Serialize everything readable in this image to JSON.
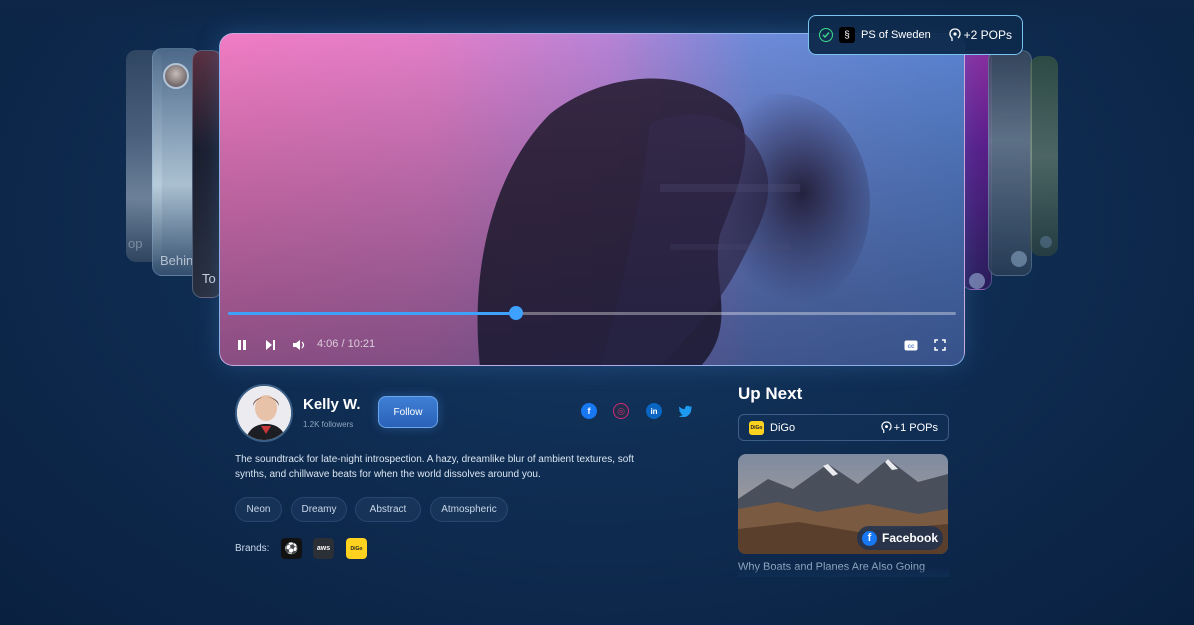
{
  "side_cards": {
    "left_texts": [
      "op",
      "Behind",
      "To"
    ]
  },
  "pops_badge": {
    "brand_icon": "ps-of-sweden-logo",
    "brand_name": "PS of Sweden",
    "pops": "+2 POPs"
  },
  "player": {
    "time": "4:06 / 10:21",
    "progress": 0.395,
    "controls": {
      "pause": "pause-icon",
      "next": "skip-next-icon",
      "volume": "volume-icon",
      "captions": "captions-icon",
      "fullscreen": "fullscreen-icon"
    }
  },
  "creator": {
    "name": "Kelly W.",
    "followers": "1.2K followers",
    "follow_label": "Follow",
    "socials": [
      {
        "name": "facebook",
        "glyph": "f",
        "color": "#1877f2"
      },
      {
        "name": "instagram",
        "glyph": "◎",
        "color": "#d62976"
      },
      {
        "name": "linkedin",
        "glyph": "in",
        "color": "#0a66c2"
      },
      {
        "name": "twitter",
        "glyph": "t",
        "color": "#1d9bf0"
      }
    ]
  },
  "description": "The soundtrack for late-night introspection. A hazy, dreamlike blur of ambient textures, soft synths, and chillwave beats for when the world dissolves around you.",
  "tags": [
    "Neon",
    "Dreamy",
    "Abstract",
    "Atmospheric"
  ],
  "brands": {
    "label": "Brands:",
    "items": [
      {
        "name": "soccer-brand-logo",
        "text": "⚽",
        "bg": "#111"
      },
      {
        "name": "aws-logo",
        "text": "aws",
        "bg": "#2b2f36"
      },
      {
        "name": "digo-logo",
        "text": "DiGo",
        "bg": "#ffd21f"
      }
    ]
  },
  "up_next": {
    "title": "Up Next",
    "card": {
      "logo_text": "DiGo",
      "name": "DiGo",
      "pops": "+1 POPs"
    },
    "thumb_pill": "Facebook",
    "thumb_title": "Why Boats and Planes Are Also Going"
  },
  "colors": {
    "accent": "#3ea0ff",
    "background": "#0f2d52",
    "badge_border": "#7bc4f0",
    "check": "#3ddc8a"
  }
}
